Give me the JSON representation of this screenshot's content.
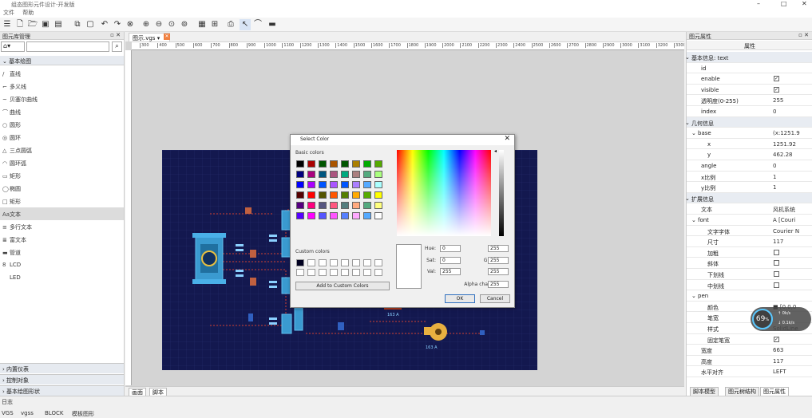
{
  "window": {
    "title": "组态图形元件设计-开发版"
  },
  "menubar": [
    "文件",
    "帮助"
  ],
  "left_panel": {
    "title": "图元库管理",
    "section": "基本绘图",
    "items": [
      {
        "icon": "/",
        "label": "直线"
      },
      {
        "icon": "⌐",
        "label": "多义线"
      },
      {
        "icon": "~",
        "label": "贝塞尔曲线"
      },
      {
        "icon": "⌒",
        "label": "曲线"
      },
      {
        "icon": "○",
        "label": "圆形"
      },
      {
        "icon": "◎",
        "label": "圆环"
      },
      {
        "icon": "△",
        "label": "三点圆弧"
      },
      {
        "icon": "◠",
        "label": "圆环弧"
      },
      {
        "icon": "▭",
        "label": "矩形"
      },
      {
        "icon": "◯",
        "label": "椭圆"
      },
      {
        "icon": "□",
        "label": "矩形"
      },
      {
        "icon": "Aa",
        "label": "文本"
      },
      {
        "icon": "≡",
        "label": "多行文本"
      },
      {
        "icon": "≣",
        "label": "富文本"
      },
      {
        "icon": "▬",
        "label": "管道"
      },
      {
        "icon": "8",
        "label": "LCD"
      },
      {
        "icon": "",
        "label": "LED"
      }
    ],
    "selected_index": 11,
    "bottom_sections": [
      "内置仪表",
      "控制对象",
      "基本绘图形状"
    ]
  },
  "document": {
    "tab": "图示.vgs",
    "ruler_ticks": [
      "300",
      "400",
      "500",
      "600",
      "700",
      "800",
      "900",
      "1000",
      "1100",
      "1200",
      "1300",
      "1400",
      "1500",
      "1600",
      "1700",
      "1800",
      "1900",
      "2000",
      "2100",
      "2200",
      "2300",
      "2400",
      "2500",
      "2600",
      "2700",
      "2800",
      "2900",
      "3000",
      "3100",
      "3200",
      "3300"
    ],
    "bottom_tabs": [
      "画面",
      "脚本"
    ],
    "canvas_labels": [
      "163 A",
      "163 A"
    ]
  },
  "dialog": {
    "title": "Select Color",
    "basic_colors_label": "Basic colors",
    "custom_colors_label": "Custom colors",
    "add_custom_label": "Add to Custom Colors",
    "ok_label": "OK",
    "cancel_label": "Cancel",
    "fields": {
      "hue": {
        "label": "Hue:",
        "value": "0"
      },
      "sat": {
        "label": "Sat:",
        "value": "0"
      },
      "val": {
        "label": "Val:",
        "value": "255"
      },
      "red": {
        "label": "Red:",
        "value": "255"
      },
      "green": {
        "label": "Green:",
        "value": "255"
      },
      "blue": {
        "label": "Blue:",
        "value": "255"
      },
      "alpha": {
        "label": "Alpha channel:",
        "value": "255"
      }
    },
    "basic_colors": [
      "#000000",
      "#aa0000",
      "#005500",
      "#aa5500",
      "#005500",
      "#aa7f00",
      "#00aa00",
      "#55aa00",
      "#00007f",
      "#aa007f",
      "#00557f",
      "#aa557f",
      "#00aa7f",
      "#aa7f7f",
      "#55aa7f",
      "#aaff7f",
      "#0000ff",
      "#aa00ff",
      "#0055ff",
      "#aa55ff",
      "#0055ff",
      "#aa7fff",
      "#55aaff",
      "#aaffff",
      "#550000",
      "#ff0000",
      "#555500",
      "#ff5500",
      "#557f00",
      "#ffaa00",
      "#55aa00",
      "#ffff00",
      "#55007f",
      "#ff007f",
      "#55557f",
      "#ff557f",
      "#557f7f",
      "#ffaa7f",
      "#55aa7f",
      "#ffff7f",
      "#5500ff",
      "#ff00ff",
      "#5555ff",
      "#ff55ff",
      "#557fff",
      "#ffaaff",
      "#55aaff",
      "#ffffff"
    ]
  },
  "right_panel": {
    "title": "图元属性",
    "header": "属性",
    "rows": [
      {
        "k": "基本信息: text",
        "v": "",
        "lvl": 0,
        "grp": true
      },
      {
        "k": "id",
        "v": "",
        "lvl": 2
      },
      {
        "k": "enable",
        "v": "✓",
        "lvl": 2,
        "cb": true
      },
      {
        "k": "visible",
        "v": "✓",
        "lvl": 2,
        "cb": true
      },
      {
        "k": "透明度(0-255)",
        "v": "255",
        "lvl": 2
      },
      {
        "k": "index",
        "v": "0",
        "lvl": 2
      },
      {
        "k": "几何信息",
        "v": "",
        "lvl": 0,
        "grp": true
      },
      {
        "k": "base",
        "v": "(x:1251.9",
        "lvl": 1
      },
      {
        "k": "x",
        "v": "1251.92",
        "lvl": 3
      },
      {
        "k": "y",
        "v": "462.28",
        "lvl": 3
      },
      {
        "k": "angle",
        "v": "0",
        "lvl": 2
      },
      {
        "k": "x比例",
        "v": "1",
        "lvl": 2
      },
      {
        "k": "y比例",
        "v": "1",
        "lvl": 2
      },
      {
        "k": "扩展信息",
        "v": "",
        "lvl": 0,
        "grp": true
      },
      {
        "k": "文本",
        "v": "风机系统",
        "lvl": 2
      },
      {
        "k": "font",
        "v": "A [Couri",
        "lvl": 1
      },
      {
        "k": "文字字体",
        "v": "Courier N",
        "lvl": 3
      },
      {
        "k": "尺寸",
        "v": "117",
        "lvl": 3
      },
      {
        "k": "加粗",
        "v": "",
        "lvl": 3,
        "cb": true
      },
      {
        "k": "斜体",
        "v": "",
        "lvl": 3,
        "cb": true
      },
      {
        "k": "下划线",
        "v": "",
        "lvl": 3,
        "cb": true
      },
      {
        "k": "中划线",
        "v": "",
        "lvl": 3,
        "cb": true
      },
      {
        "k": "pen",
        "v": "",
        "lvl": 1
      },
      {
        "k": "颜色",
        "v": "■ [0,0,0",
        "lvl": 3
      },
      {
        "k": "笔宽",
        "v": "",
        "lvl": 3
      },
      {
        "k": "样式",
        "v": "SolidLine",
        "lvl": 3
      },
      {
        "k": "固定笔宽",
        "v": "✓",
        "lvl": 3,
        "cb": true
      },
      {
        "k": "宽度",
        "v": "663",
        "lvl": 2
      },
      {
        "k": "高度",
        "v": "117",
        "lvl": 2
      },
      {
        "k": "水平对齐",
        "v": "LEFT",
        "lvl": 2
      }
    ],
    "bottom_tabs": [
      "脚本模型",
      "图元树结构",
      "图元属性"
    ],
    "overlay": {
      "percent": "69",
      "unit": "%",
      "up": "0k/s",
      "down": "0.1k/s"
    }
  },
  "status": {
    "title": "日志",
    "tabs": [
      "VGS",
      "vgss",
      "BLOCK",
      "模板图形"
    ]
  }
}
